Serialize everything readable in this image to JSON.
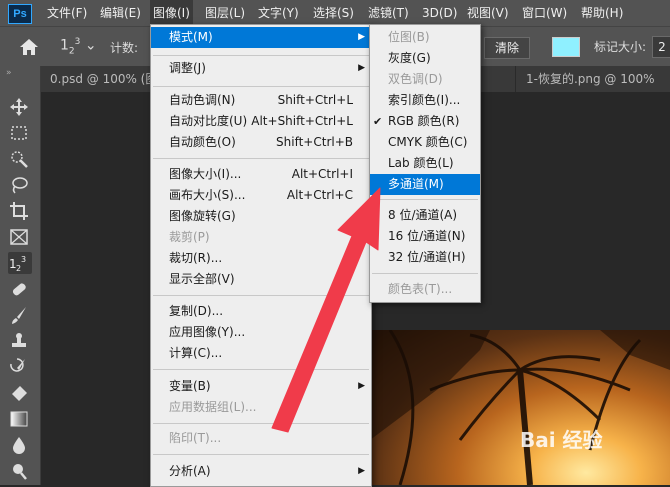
{
  "app": {
    "logo": "Ps"
  },
  "menubar": {
    "items": [
      "文件(F)",
      "编辑(E)",
      "图像(I)",
      "图层(L)",
      "文字(Y)",
      "选择(S)",
      "滤镜(T)",
      "3D(D)",
      "视图(V)",
      "窗口(W)",
      "帮助(H)"
    ],
    "active": "图像(I)"
  },
  "options": {
    "count_label": "计数:",
    "clear_label": "清除",
    "mark_size_label": "标记大小:",
    "mark_size_value": "2",
    "swatch_color": "#8ff0ff"
  },
  "tabs": [
    "0.psd @ 100% (图",
    "1-恢复的.png @ 100%"
  ],
  "image_menu": {
    "items": [
      {
        "label": "模式(M)",
        "shortcut": "",
        "submenu": true,
        "highlighted": true
      },
      {
        "label": "调整(J)",
        "shortcut": "",
        "submenu": true
      },
      {
        "label": "自动色调(N)",
        "shortcut": "Shift+Ctrl+L"
      },
      {
        "label": "自动对比度(U)",
        "shortcut": "Alt+Shift+Ctrl+L"
      },
      {
        "label": "自动颜色(O)",
        "shortcut": "Shift+Ctrl+B"
      },
      {
        "label": "图像大小(I)...",
        "shortcut": "Alt+Ctrl+I"
      },
      {
        "label": "画布大小(S)...",
        "shortcut": "Alt+Ctrl+C"
      },
      {
        "label": "图像旋转(G)",
        "shortcut": "",
        "submenu": true
      },
      {
        "label": "裁剪(P)",
        "shortcut": "",
        "disabled": true
      },
      {
        "label": "裁切(R)...",
        "shortcut": ""
      },
      {
        "label": "显示全部(V)",
        "shortcut": ""
      },
      {
        "label": "复制(D)...",
        "shortcut": ""
      },
      {
        "label": "应用图像(Y)...",
        "shortcut": ""
      },
      {
        "label": "计算(C)...",
        "shortcut": ""
      },
      {
        "label": "变量(B)",
        "shortcut": "",
        "submenu": true
      },
      {
        "label": "应用数据组(L)...",
        "shortcut": "",
        "disabled": true
      },
      {
        "label": "陷印(T)...",
        "shortcut": "",
        "disabled": true
      },
      {
        "label": "分析(A)",
        "shortcut": "",
        "submenu": true
      }
    ]
  },
  "mode_submenu": {
    "items": [
      {
        "label": "位图(B)",
        "disabled": true
      },
      {
        "label": "灰度(G)"
      },
      {
        "label": "双色调(D)",
        "disabled": true
      },
      {
        "label": "索引颜色(I)..."
      },
      {
        "label": "RGB 颜色(R)",
        "checked": true
      },
      {
        "label": "CMYK 颜色(C)"
      },
      {
        "label": "Lab 颜色(L)"
      },
      {
        "label": "多通道(M)",
        "highlighted": true
      },
      {
        "label": "8 位/通道(A)"
      },
      {
        "label": "16 位/通道(N)"
      },
      {
        "label": "32 位/通道(H)"
      },
      {
        "label": "颜色表(T)...",
        "disabled": true
      }
    ]
  },
  "watermark": "Bai 经验",
  "colors": {
    "highlight": "#0078d7",
    "arrow": "#f03b4a",
    "menu_bg": "#eeeeee"
  }
}
